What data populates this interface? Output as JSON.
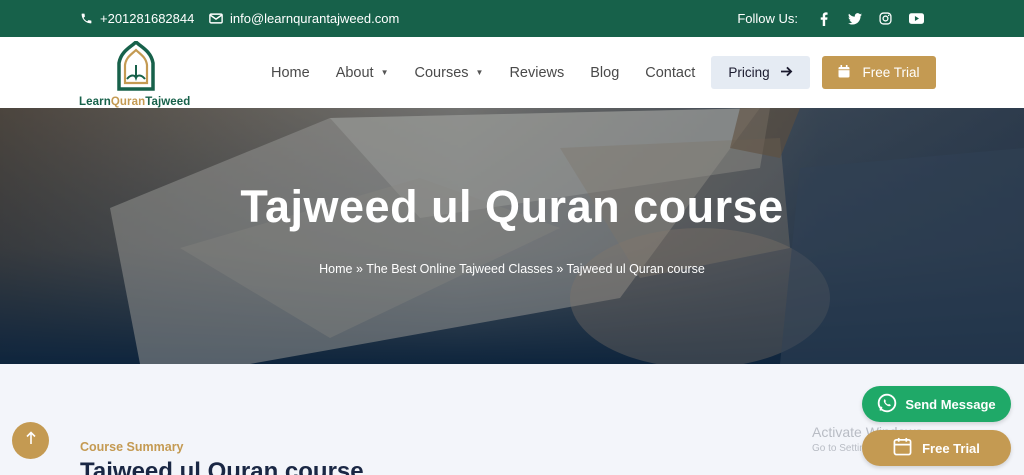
{
  "topbar": {
    "phone": "+201281682844",
    "email": "info@learnqurantajweed.com",
    "follow_label": "Follow Us:",
    "socials": [
      "facebook-icon",
      "twitter-icon",
      "instagram-icon",
      "youtube-icon"
    ]
  },
  "logo": {
    "part1": "Learn",
    "part2": "Quran",
    "part3": "Tajweed"
  },
  "nav": {
    "items": [
      {
        "label": "Home"
      },
      {
        "label": "About"
      },
      {
        "label": "Courses"
      },
      {
        "label": "Reviews"
      },
      {
        "label": "Blog"
      },
      {
        "label": "Contact"
      }
    ]
  },
  "header_buttons": {
    "pricing": "Pricing",
    "free_trial": "Free Trial"
  },
  "hero": {
    "title": "Tajweed ul Quran course",
    "breadcrumb": {
      "home": "Home",
      "sep1": "»",
      "section": "The Best Online Tajweed Classes",
      "sep2": "»",
      "current": "Tajweed ul Quran course"
    }
  },
  "content": {
    "summary_label": "Course Summary",
    "summary_title": "Tajweed ul Quran course"
  },
  "floating": {
    "send_message": "Send Message",
    "free_trial": "Free Trial"
  },
  "watermark": {
    "line1": "Activate Windows",
    "line2": "Go to Settings to activate Windows."
  },
  "colors": {
    "brand_green": "#17614a",
    "brand_gold": "#c49a52",
    "whatsapp_green": "#1fa968",
    "navy": "#1a2744"
  }
}
